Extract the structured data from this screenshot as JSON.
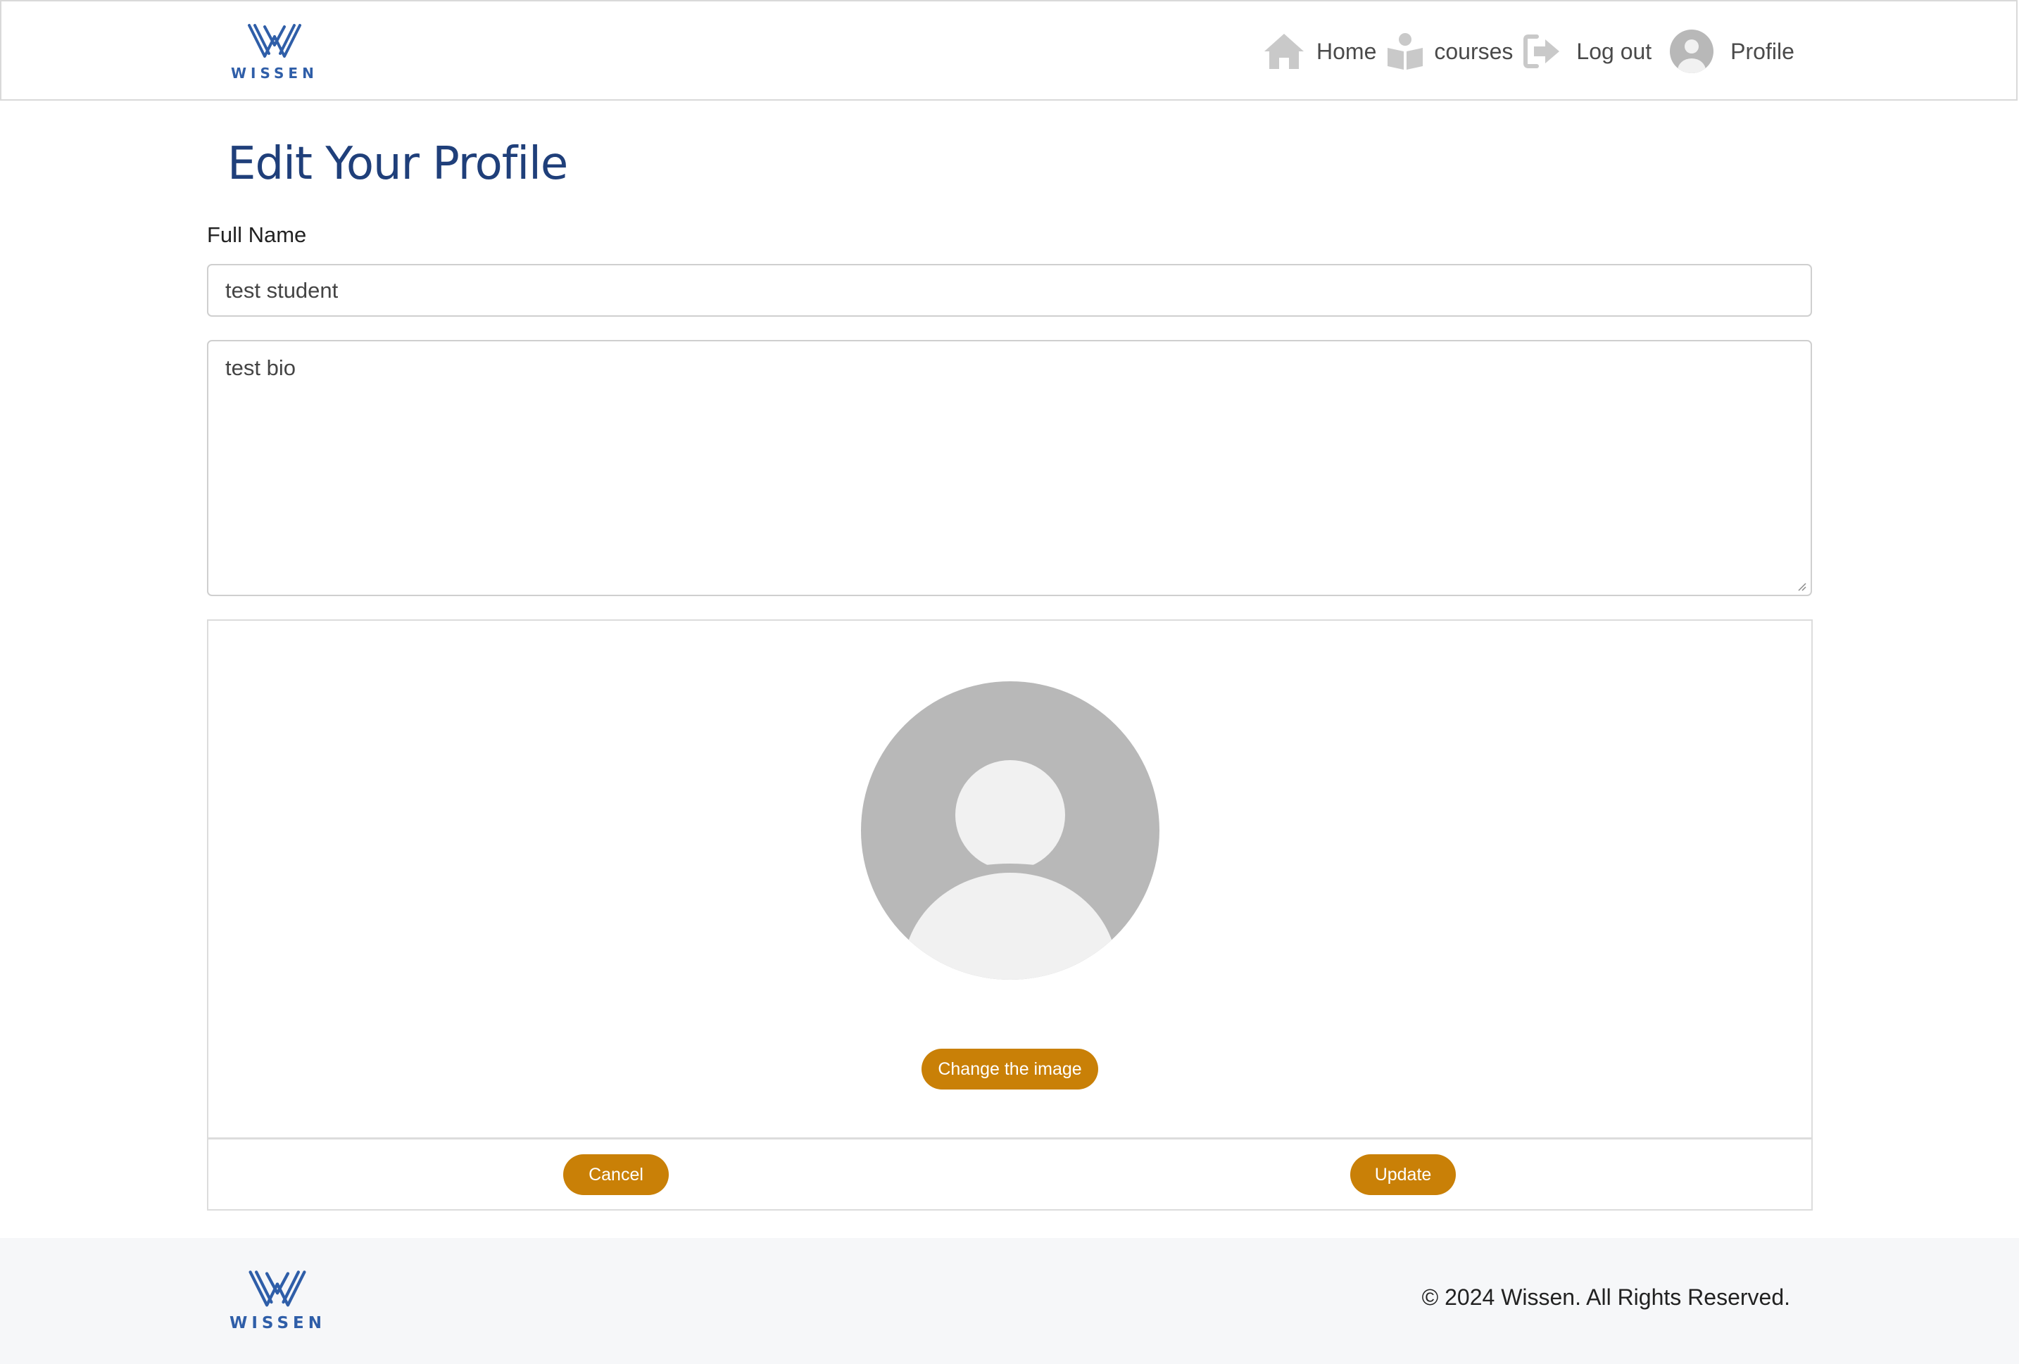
{
  "brand": {
    "name": "WISSEN",
    "color": "#2f5ea8"
  },
  "nav": {
    "items": [
      {
        "label": "Home",
        "icon": "home-icon"
      },
      {
        "label": "courses",
        "icon": "book-reader-icon"
      },
      {
        "label": "Log out",
        "icon": "logout-icon"
      },
      {
        "label": "Profile",
        "icon": "user-avatar-icon"
      }
    ]
  },
  "page": {
    "title": "Edit Your Profile"
  },
  "form": {
    "full_name_label": "Full Name",
    "full_name_value": "test student",
    "bio_value": "test bio"
  },
  "image_section": {
    "change_image_label": "Change the image",
    "avatar_icon": "default-user-avatar-icon"
  },
  "actions": {
    "cancel_label": "Cancel",
    "update_label": "Update"
  },
  "footer": {
    "copyright": "© 2024 Wissen. All Rights Reserved."
  },
  "colors": {
    "accent": "#c98007",
    "title": "#1f3f7a",
    "footer_bg": "#f6f7f9"
  }
}
